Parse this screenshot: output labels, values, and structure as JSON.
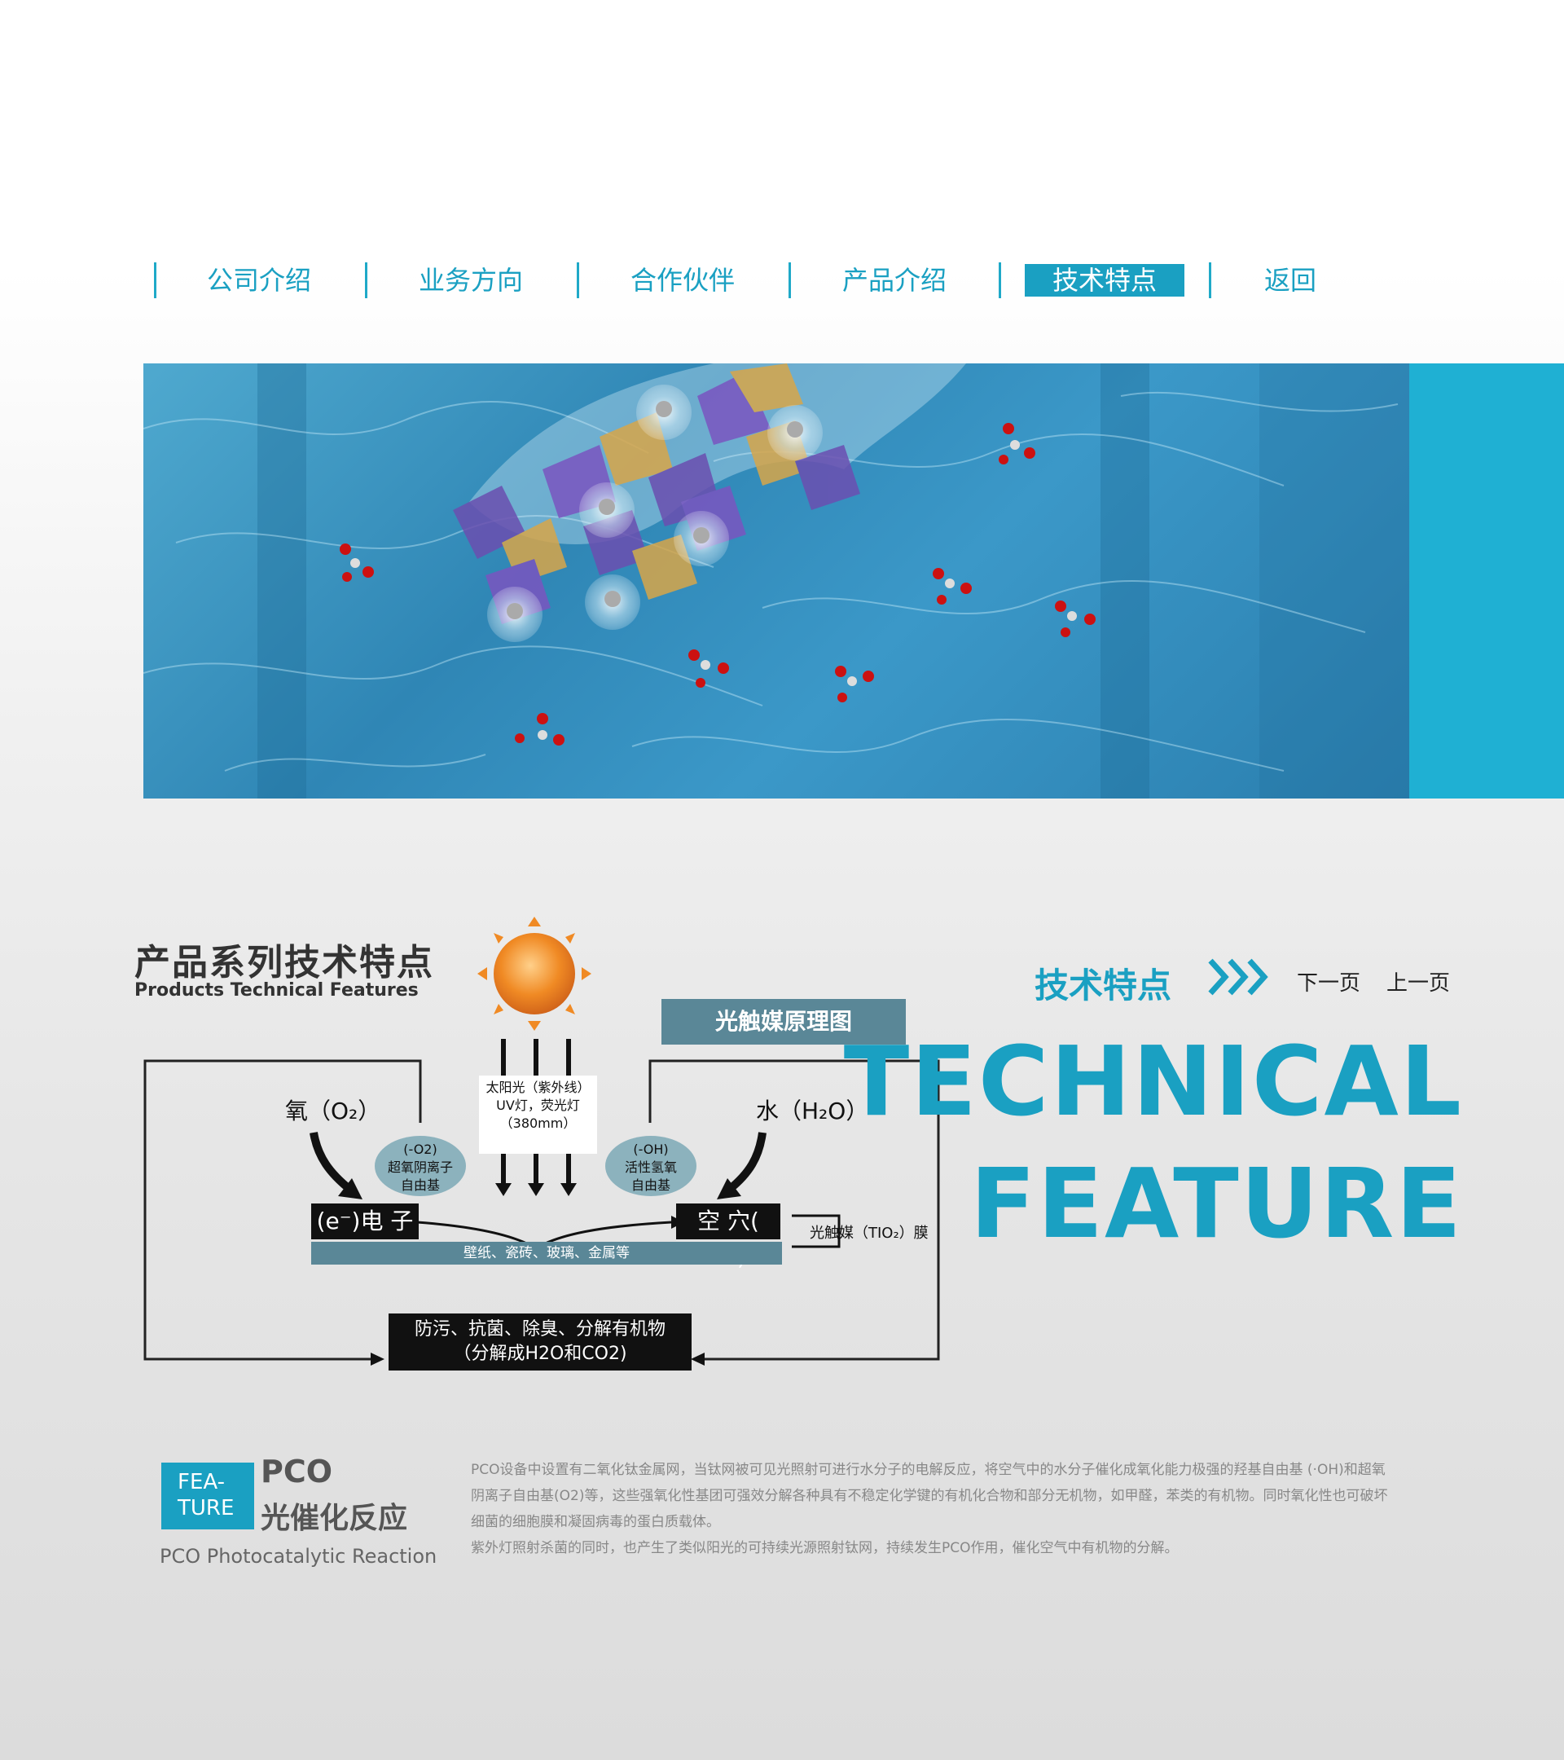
{
  "nav": {
    "items": [
      {
        "label": "公司介绍",
        "active": false
      },
      {
        "label": "业务方向",
        "active": false
      },
      {
        "label": "合作伙伴",
        "active": false
      },
      {
        "label": "产品介绍",
        "active": false
      },
      {
        "label": "技术特点",
        "active": true
      },
      {
        "label": "返回",
        "active": false
      }
    ]
  },
  "section": {
    "title_zh": "产品系列技术特点",
    "title_en": "Products Technical Features"
  },
  "diagram": {
    "header": "光触媒原理图",
    "sunlight": [
      "太阳光（紫外线）",
      "UV灯，荧光灯",
      "（380mm）"
    ],
    "oxygen": "氧（O₂）",
    "water": "水（H₂O）",
    "superoxide": [
      "(-O2)",
      "超氧阴离子",
      "自由基"
    ],
    "hydroxyl": [
      "(-OH)",
      "活性氢氧",
      "自由基"
    ],
    "electron": "(e⁻)电 子",
    "hole": "空 穴( h⁺)",
    "surface": "壁纸、瓷砖、玻璃、金属等",
    "film": "光触媒（TIO₂）膜",
    "result": [
      "防污、抗菌、除臭、分解有机物",
      "（分解成H2O和CO2)"
    ]
  },
  "right": {
    "title_zh": "技术特点",
    "next": "下一页",
    "prev": "上一页",
    "big_line1": "TECHNICAL",
    "big_line2": "FEATURE"
  },
  "feature": {
    "box_line1": "FEA-",
    "box_line2": "TURE",
    "pco": "PCO",
    "title_zh": "光催化反应",
    "title_en": "PCO Photocatalytic Reaction",
    "paragraphs": [
      "PCO设备中设置有二氧化钛金属网，当钛网被可见光照射可进行水分子的电解反应，将空气中的水分子催化成氧化能力极强的羟基自由基 (·OH)和超氧阴离子自由基(O2)等，这些强氧化性基团可强效分解各种具有不稳定化学键的有机化合物和部分无机物，如甲醛，苯类的有机物。同时氧化性也可破坏细菌的细胞膜和凝固病毒的蛋白质载体。",
      "紫外灯照射杀菌的同时，也产生了类似阳光的可持续光源照射钛网，持续发生PCO作用，催化空气中有机物的分解。"
    ]
  },
  "colors": {
    "accent": "#1aa0c2",
    "side_band": "#1fb0d3",
    "teal_bar": "#5a8797",
    "ellipse": "#8cb2bd"
  }
}
